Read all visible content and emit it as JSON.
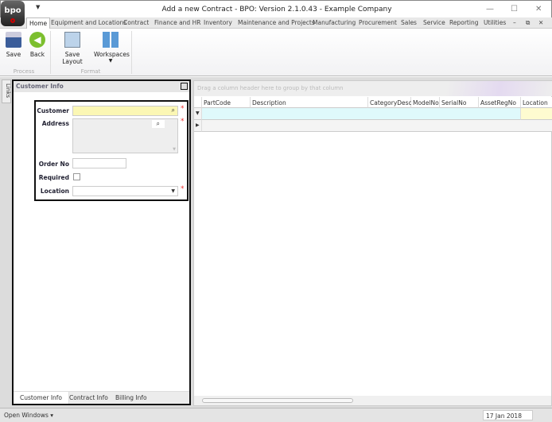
{
  "window": {
    "title": "Add a new Contract - BPO: Version 2.1.0.43 - Example Company",
    "logo_text": "bpo"
  },
  "menu_tabs": [
    "Home",
    "Equipment and Locations",
    "Contract",
    "Finance and HR",
    "Inventory",
    "Maintenance and Projects",
    "Manufacturing",
    "Procurement",
    "Sales",
    "Service",
    "Reporting",
    "Utilities"
  ],
  "ribbon": {
    "save": "Save",
    "back": "Back",
    "save_layout": "Save Layout",
    "workspaces": "Workspaces",
    "group_process": "Process",
    "group_format": "Format"
  },
  "side": {
    "links": "Links"
  },
  "panel": {
    "title": "Customer Info",
    "customer_label": "Customer",
    "address_label": "Address",
    "order_label": "Order No",
    "required_label": "Required",
    "location_label": "Location",
    "customer_value": "",
    "order_value": "",
    "location_value": ""
  },
  "bottom_tabs": [
    "Customer Info",
    "Contract Info",
    "Billing Info"
  ],
  "grid": {
    "group_hint": "Drag a column header here to group by that column",
    "columns": [
      "PartCode",
      "Description",
      "CategoryDesc",
      "ModelNo",
      "SerialNo",
      "AssetRegNo",
      "Location"
    ]
  },
  "status": {
    "open_windows": "Open Windows",
    "date": "17 Jan 2018"
  }
}
